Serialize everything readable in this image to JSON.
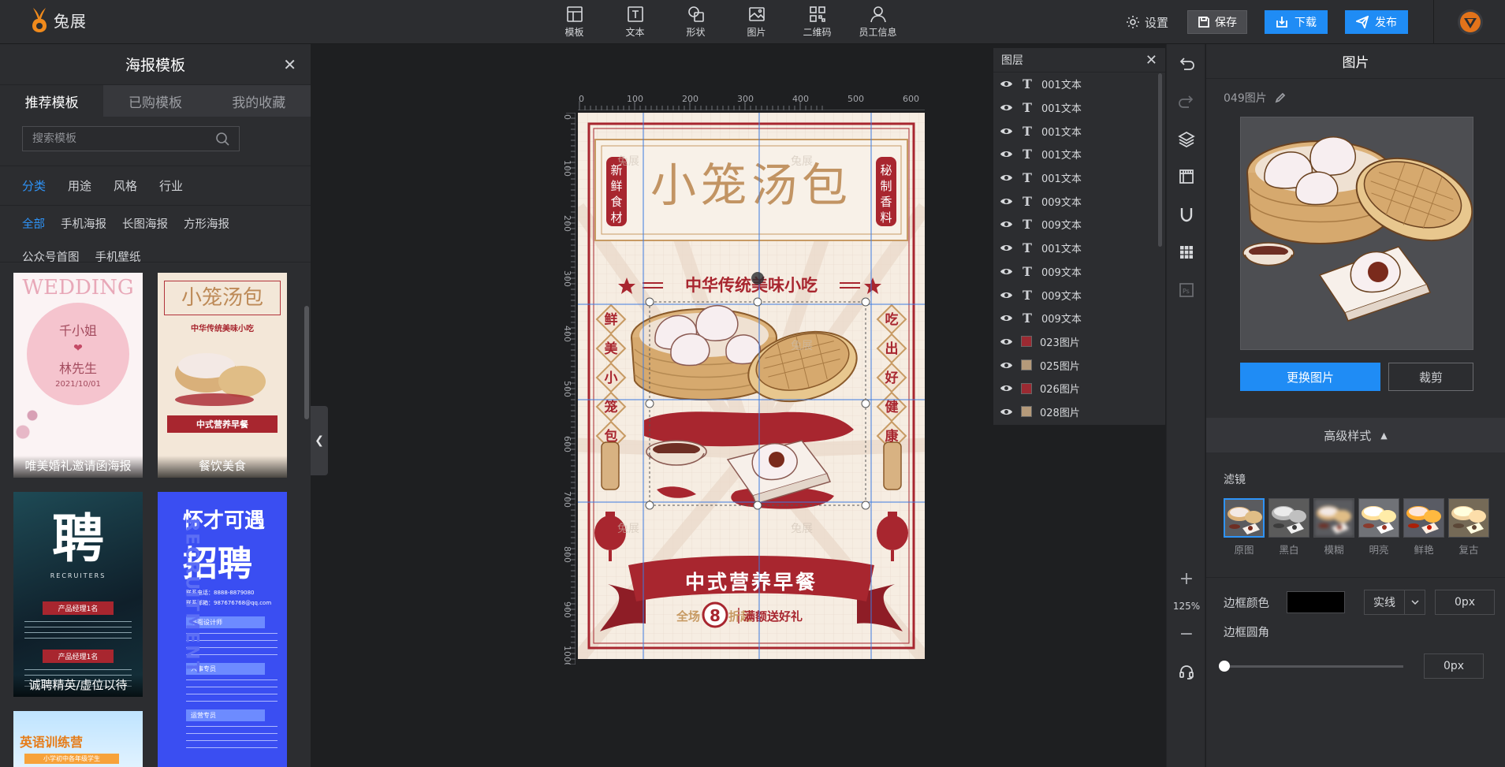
{
  "brand": {
    "name": "兔展"
  },
  "toolbar": {
    "tools": [
      {
        "id": "template",
        "label": "模板"
      },
      {
        "id": "text",
        "label": "文本"
      },
      {
        "id": "shape",
        "label": "形状"
      },
      {
        "id": "image",
        "label": "图片"
      },
      {
        "id": "qrcode",
        "label": "二维码"
      },
      {
        "id": "staff",
        "label": "员工信息"
      }
    ],
    "settings_label": "设置",
    "save_label": "保存",
    "download_label": "下载",
    "publish_label": "发布"
  },
  "left_panel": {
    "title": "海报模板",
    "tabs": [
      "推荐模板",
      "已购模板",
      "我的收藏"
    ],
    "active_tab": 0,
    "search_placeholder": "搜索模板",
    "categories": [
      "分类",
      "用途",
      "风格",
      "行业"
    ],
    "subcategories": [
      "全部",
      "手机海报",
      "长图海报",
      "方形海报",
      "公众号首图",
      "手机壁纸"
    ],
    "templates": [
      {
        "label": "唯美婚礼邀请函海报",
        "title": "WEDDING",
        "line1": "千小姐",
        "heart": "❤",
        "line2": "林先生",
        "date": "2021/10/01"
      },
      {
        "label": "餐饮美食",
        "title": "小笼汤包",
        "sub": "中华传统美味小吃",
        "ribbon": "中式营养早餐"
      },
      {
        "label": "诚聘精英/虚位以待",
        "title": "聘",
        "sub": "RECRUITERS",
        "tag1": "产品经理1名",
        "tag2": "产品经理1名"
      },
      {
        "label": "",
        "title": "怀才可遇",
        "title2": "招聘",
        "vertical": "RECRUITMENT",
        "phone": "联系电话：8888-8879080",
        "email": "联系邮箱：987676768@qq.com",
        "sec1": "平面设计师",
        "sec2": "人事专员",
        "sec3": "运营专员"
      },
      {
        "label": "",
        "title": "英语训练营",
        "sub": "小学初中各年级学生"
      }
    ]
  },
  "poster": {
    "title": "小笼汤包",
    "badge_left": "新鲜食材",
    "badge_right": "秘制香料",
    "subtitle": "中华传统美味小吃",
    "vert_left": [
      "鲜",
      "美",
      "小",
      "笼",
      "包"
    ],
    "vert_right": [
      "吃",
      "出",
      "好",
      "健",
      "康"
    ],
    "ribbon": "中式营养早餐",
    "promo_a": "全场",
    "promo_num": "8",
    "promo_b": "折起",
    "promo_c": "满额送好礼",
    "watermark": "兔展",
    "ruler_top": [
      "0",
      "100",
      "200",
      "300",
      "400",
      "500",
      "600"
    ],
    "ruler_left": [
      "0",
      "100",
      "200",
      "300",
      "400",
      "500",
      "600",
      "700",
      "800",
      "900",
      "1000"
    ]
  },
  "layers": {
    "title": "图层",
    "items": [
      {
        "type": "text",
        "name": "001文本"
      },
      {
        "type": "text",
        "name": "001文本"
      },
      {
        "type": "text",
        "name": "001文本"
      },
      {
        "type": "text",
        "name": "001文本"
      },
      {
        "type": "text",
        "name": "001文本"
      },
      {
        "type": "text",
        "name": "009文本"
      },
      {
        "type": "text",
        "name": "009文本"
      },
      {
        "type": "text",
        "name": "001文本"
      },
      {
        "type": "text",
        "name": "009文本"
      },
      {
        "type": "text",
        "name": "009文本"
      },
      {
        "type": "text",
        "name": "009文本"
      },
      {
        "type": "image",
        "name": "023图片",
        "color": "#9b2a32"
      },
      {
        "type": "image",
        "name": "025图片",
        "color": "#b59a7a"
      },
      {
        "type": "image",
        "name": "026图片",
        "color": "#9b2a32"
      },
      {
        "type": "image",
        "name": "028图片",
        "color": "#b59a7a"
      }
    ]
  },
  "zoom": {
    "level": "125%"
  },
  "right_panel": {
    "title": "图片",
    "layer_name": "049图片",
    "replace_label": "更换图片",
    "crop_label": "裁剪",
    "advanced_label": "高级样式",
    "filter_title": "滤镜",
    "filters": [
      "原图",
      "黑白",
      "模糊",
      "明亮",
      "鲜艳",
      "复古"
    ],
    "active_filter": 0,
    "border_color_label": "边框颜色",
    "border_color": "#000000",
    "border_style": "实线",
    "border_width": "0px",
    "radius_label": "边框圆角",
    "radius_value": "0px",
    "radius_level": 0
  },
  "colors": {
    "accent": "#1f8cf5",
    "poster_red": "#a8262f",
    "poster_gold": "#c79a63"
  }
}
